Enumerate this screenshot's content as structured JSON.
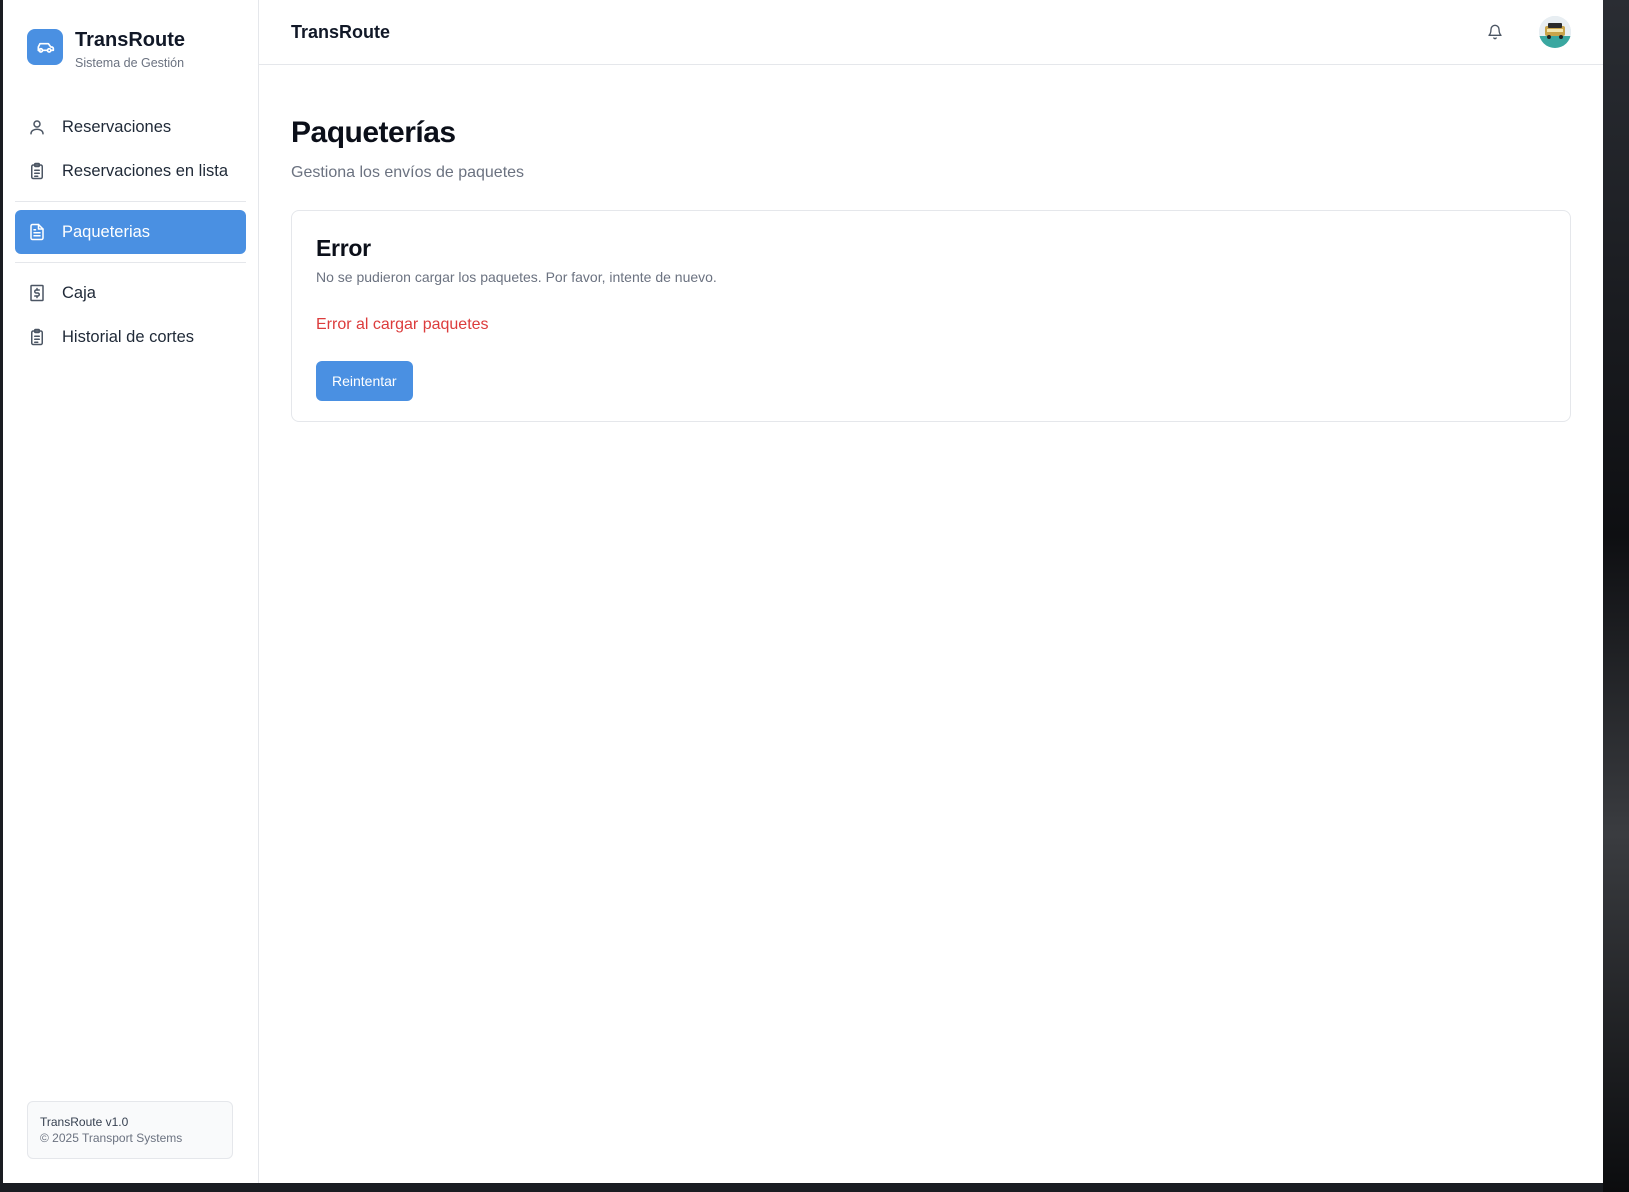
{
  "brand": {
    "title": "TransRoute",
    "subtitle": "Sistema de Gestión"
  },
  "sidebar": {
    "items": [
      {
        "label": "Reservaciones",
        "icon": "user-icon"
      },
      {
        "label": "Reservaciones en lista",
        "icon": "clipboard-list-icon"
      },
      {
        "label": "Paqueterias",
        "icon": "file-text-icon",
        "active": true
      },
      {
        "label": "Caja",
        "icon": "receipt-dollar-icon"
      },
      {
        "label": "Historial de cortes",
        "icon": "clipboard-list-icon"
      }
    ],
    "footer": {
      "version": "TransRoute v1.0",
      "copyright": "© 2025 Transport Systems"
    }
  },
  "header": {
    "title": "TransRoute",
    "bell_icon": "bell-icon",
    "avatar": "user-avatar"
  },
  "main": {
    "title": "Paqueterías",
    "subtitle": "Gestiona los envíos de paquetes",
    "error_card": {
      "title": "Error",
      "description": "No se pudieron cargar los paquetes. Por favor, intente de nuevo.",
      "message": "Error al cargar paquetes",
      "retry_label": "Reintentar"
    }
  },
  "colors": {
    "accent": "#4a90e2",
    "error": "#dc3c3c",
    "border": "#e5e7eb"
  }
}
